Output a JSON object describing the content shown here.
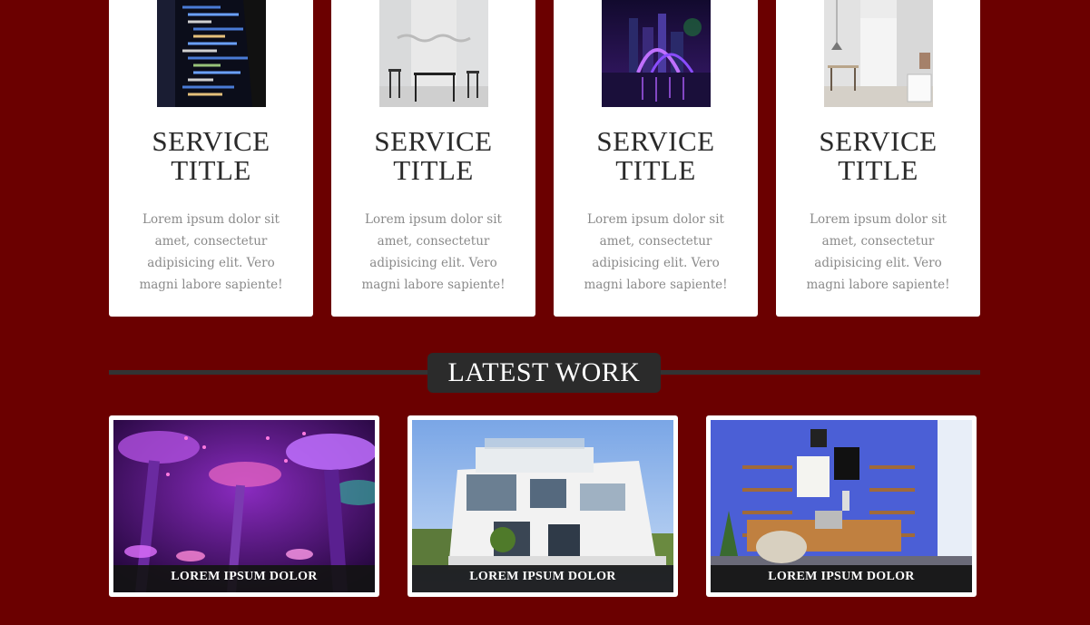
{
  "services": [
    {
      "title": "SERVICE TITLE",
      "text": "Lorem ipsum dolor sit amet, consectetur adipisicing elit. Vero magni labore sapiente!",
      "image": "code-screen-image"
    },
    {
      "title": "SERVICE TITLE",
      "text": "Lorem ipsum dolor sit amet, consectetur adipisicing elit. Vero magni labore sapiente!",
      "image": "minimal-interior-image"
    },
    {
      "title": "SERVICE TITLE",
      "text": "Lorem ipsum dolor sit amet, consectetur adipisicing elit. Vero magni labore sapiente!",
      "image": "night-city-image"
    },
    {
      "title": "SERVICE TITLE",
      "text": "Lorem ipsum dolor sit amet, consectetur adipisicing elit. Vero magni labore sapiente!",
      "image": "hallway-interior-image"
    }
  ],
  "latest_work": {
    "title": "LATEST WORK",
    "items": [
      {
        "caption": "LOREM IPSUM DOLOR",
        "image": "supertree-grove-image"
      },
      {
        "caption": "LOREM IPSUM DOLOR",
        "image": "white-villa-image"
      },
      {
        "caption": "LOREM IPSUM DOLOR",
        "image": "blue-office-image"
      }
    ]
  },
  "colors": {
    "background": "#6b0000",
    "card": "#ffffff",
    "title_badge": "#2b2b2b",
    "divider": "#333333"
  }
}
